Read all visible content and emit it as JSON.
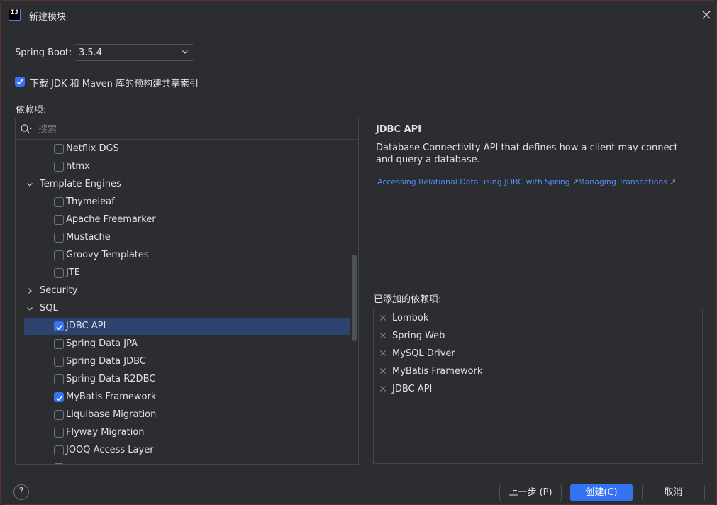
{
  "window": {
    "title": "新建模块",
    "app_icon_text": "IJ"
  },
  "spring_boot": {
    "label": "Spring Boot:",
    "selected_version": "3.5.4"
  },
  "download_index": {
    "label": "下载 JDK 和 Maven 库的预构建共享索引",
    "checked": true
  },
  "dependencies": {
    "label": "依赖项:",
    "search_placeholder": "搜索",
    "tree": [
      {
        "label": "Netflix DGS",
        "kind": "item",
        "checked": false
      },
      {
        "label": "htmx",
        "kind": "item",
        "checked": false
      },
      {
        "label": "Template Engines",
        "kind": "group",
        "expanded": true
      },
      {
        "label": "Thymeleaf",
        "kind": "item",
        "checked": false
      },
      {
        "label": "Apache Freemarker",
        "kind": "item",
        "checked": false
      },
      {
        "label": "Mustache",
        "kind": "item",
        "checked": false
      },
      {
        "label": "Groovy Templates",
        "kind": "item",
        "checked": false
      },
      {
        "label": "JTE",
        "kind": "item",
        "checked": false
      },
      {
        "label": "Security",
        "kind": "group",
        "expanded": false
      },
      {
        "label": "SQL",
        "kind": "group",
        "expanded": true
      },
      {
        "label": "JDBC API",
        "kind": "item",
        "checked": true,
        "selected": true
      },
      {
        "label": "Spring Data JPA",
        "kind": "item",
        "checked": false
      },
      {
        "label": "Spring Data JDBC",
        "kind": "item",
        "checked": false
      },
      {
        "label": "Spring Data R2DBC",
        "kind": "item",
        "checked": false
      },
      {
        "label": "MyBatis Framework",
        "kind": "item",
        "checked": true
      },
      {
        "label": "Liquibase Migration",
        "kind": "item",
        "checked": false
      },
      {
        "label": "Flyway Migration",
        "kind": "item",
        "checked": false
      },
      {
        "label": "JOOQ Access Layer",
        "kind": "item",
        "checked": false
      }
    ]
  },
  "detail": {
    "title": "JDBC API",
    "description": "Database Connectivity API that defines how a client may connect and query a database.",
    "links": [
      "Accessing Relational Data using JDBC with Spring",
      "Managing Transactions"
    ],
    "link_arrow": "↗"
  },
  "added": {
    "label": "已添加的依赖项:",
    "items": [
      "Lombok",
      "Spring Web",
      "MySQL Driver",
      "MyBatis Framework",
      "JDBC API"
    ]
  },
  "footer": {
    "help": "?",
    "prev_label": "上一步 (P)",
    "create_label": "创建(C)",
    "cancel_label": "取消"
  },
  "colors": {
    "background": "#2b2d30",
    "accent": "#3574f0",
    "selection": "#2e436e",
    "link": "#548af7"
  }
}
